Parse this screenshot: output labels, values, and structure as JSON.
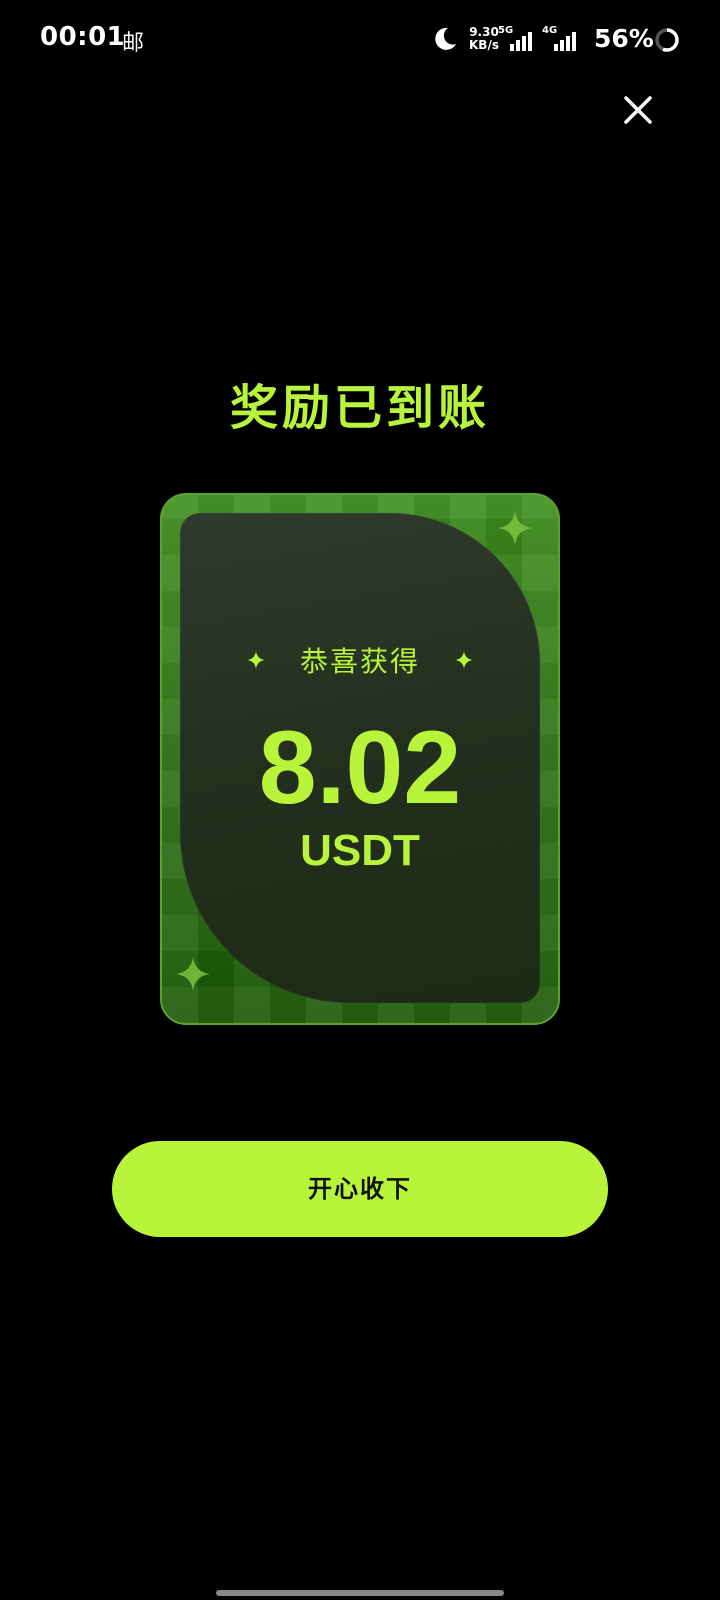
{
  "status_bar": {
    "time": "00:01",
    "mail_icon": "邮",
    "net_speed_value": "9.30",
    "net_speed_unit": "KB/s",
    "sim1_type": "5G",
    "sim2_type": "4G",
    "battery_percent": "56%",
    "icons": [
      "moon-icon",
      "signal-bars-icon",
      "battery-ring-icon"
    ]
  },
  "modal": {
    "close_icon": "close-icon",
    "title": "奖励已到账",
    "card": {
      "subtitle": "恭喜获得",
      "amount": "8.02",
      "currency": "USDT"
    },
    "accept_button": "开心收下"
  },
  "colors": {
    "accent": "#b8f53a",
    "background": "#000000",
    "card_green": "#2d7413",
    "card_inner": "#24301f"
  }
}
